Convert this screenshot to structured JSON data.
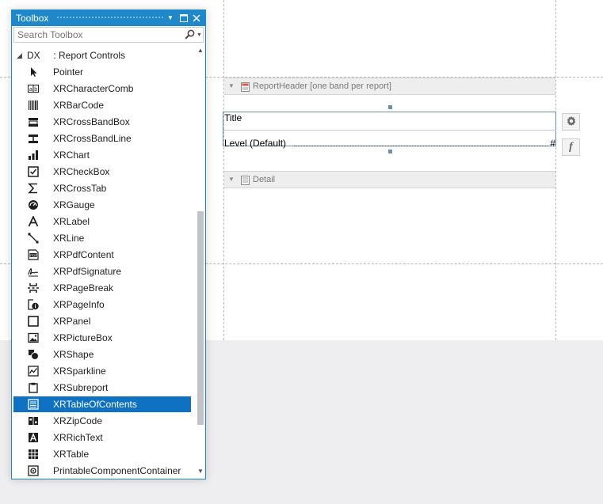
{
  "toolbox": {
    "title": "Toolbox",
    "search_placeholder": "Search Toolbox",
    "category": {
      "prefix": "DX",
      "name": ": Report Controls"
    },
    "items": [
      {
        "label": "Pointer",
        "icon": "pointer-icon"
      },
      {
        "label": "XRCharacterComb",
        "icon": "character-comb-icon"
      },
      {
        "label": "XRBarCode",
        "icon": "barcode-icon"
      },
      {
        "label": "XRCrossBandBox",
        "icon": "cross-band-box-icon"
      },
      {
        "label": "XRCrossBandLine",
        "icon": "cross-band-line-icon"
      },
      {
        "label": "XRChart",
        "icon": "chart-icon"
      },
      {
        "label": "XRCheckBox",
        "icon": "checkbox-icon"
      },
      {
        "label": "XRCrossTab",
        "icon": "crosstab-icon"
      },
      {
        "label": "XRGauge",
        "icon": "gauge-icon"
      },
      {
        "label": "XRLabel",
        "icon": "label-icon"
      },
      {
        "label": "XRLine",
        "icon": "line-icon"
      },
      {
        "label": "XRPdfContent",
        "icon": "pdf-content-icon"
      },
      {
        "label": "XRPdfSignature",
        "icon": "pdf-signature-icon"
      },
      {
        "label": "XRPageBreak",
        "icon": "page-break-icon"
      },
      {
        "label": "XRPageInfo",
        "icon": "page-info-icon"
      },
      {
        "label": "XRPanel",
        "icon": "panel-icon"
      },
      {
        "label": "XRPictureBox",
        "icon": "picture-box-icon"
      },
      {
        "label": "XRShape",
        "icon": "shape-icon"
      },
      {
        "label": "XRSparkline",
        "icon": "sparkline-icon"
      },
      {
        "label": "XRSubreport",
        "icon": "subreport-icon"
      },
      {
        "label": "XRTableOfContents",
        "icon": "table-of-contents-icon"
      },
      {
        "label": "XRZipCode",
        "icon": "zipcode-icon"
      },
      {
        "label": "XRRichText",
        "icon": "rich-text-icon"
      },
      {
        "label": "XRTable",
        "icon": "table-icon"
      },
      {
        "label": "PrintableComponentContainer",
        "icon": "printable-component-icon"
      }
    ],
    "selected_item": "XRTableOfContents"
  },
  "designer": {
    "report_header_band": "ReportHeader [one band per report]",
    "detail_band": "Detail",
    "title_text": "Title",
    "level_text": "Level (Default)",
    "page_number_symbol": "#",
    "function_button": "f"
  },
  "colors": {
    "accent": "#1e88c8",
    "selection": "#0e71c1",
    "band_header": "#eeeeee"
  }
}
